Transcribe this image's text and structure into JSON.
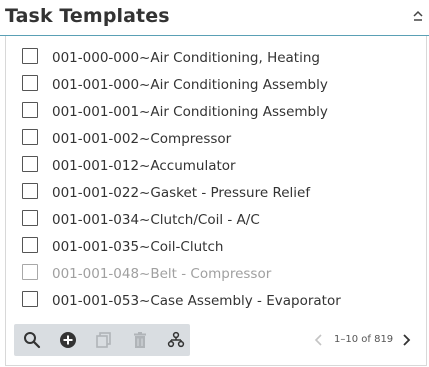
{
  "header": {
    "title": "Task Templates"
  },
  "list": {
    "items": [
      {
        "label": "001-000-000~Air Conditioning, Heating",
        "checked": false,
        "muted": false
      },
      {
        "label": "001-001-000~Air Conditioning Assembly",
        "checked": false,
        "muted": false
      },
      {
        "label": "001-001-001~Air Conditioning Assembly",
        "checked": false,
        "muted": false
      },
      {
        "label": "001-001-002~Compressor",
        "checked": false,
        "muted": false
      },
      {
        "label": "001-001-012~Accumulator",
        "checked": false,
        "muted": false
      },
      {
        "label": "001-001-022~Gasket - Pressure Relief",
        "checked": false,
        "muted": false
      },
      {
        "label": "001-001-034~Clutch/Coil - A/C",
        "checked": false,
        "muted": false
      },
      {
        "label": "001-001-035~Coil-Clutch",
        "checked": false,
        "muted": false
      },
      {
        "label": "001-001-048~Belt - Compressor",
        "checked": false,
        "muted": true
      },
      {
        "label": "001-001-053~Case Assembly - Evaporator",
        "checked": false,
        "muted": false
      }
    ]
  },
  "toolbar": {
    "buttons": [
      {
        "icon": "search-icon",
        "enabled": true
      },
      {
        "icon": "add-circle-icon",
        "enabled": true
      },
      {
        "icon": "copy-icon",
        "enabled": false
      },
      {
        "icon": "trash-icon",
        "enabled": false
      },
      {
        "icon": "hierarchy-icon",
        "enabled": true
      }
    ]
  },
  "pager": {
    "range_text": "1–10 of 819"
  },
  "colors": {
    "accent_border": "#5aa0b5",
    "toolbar_bg": "#d9dde1",
    "text": "#333333",
    "muted_text": "#a0a0a0"
  }
}
